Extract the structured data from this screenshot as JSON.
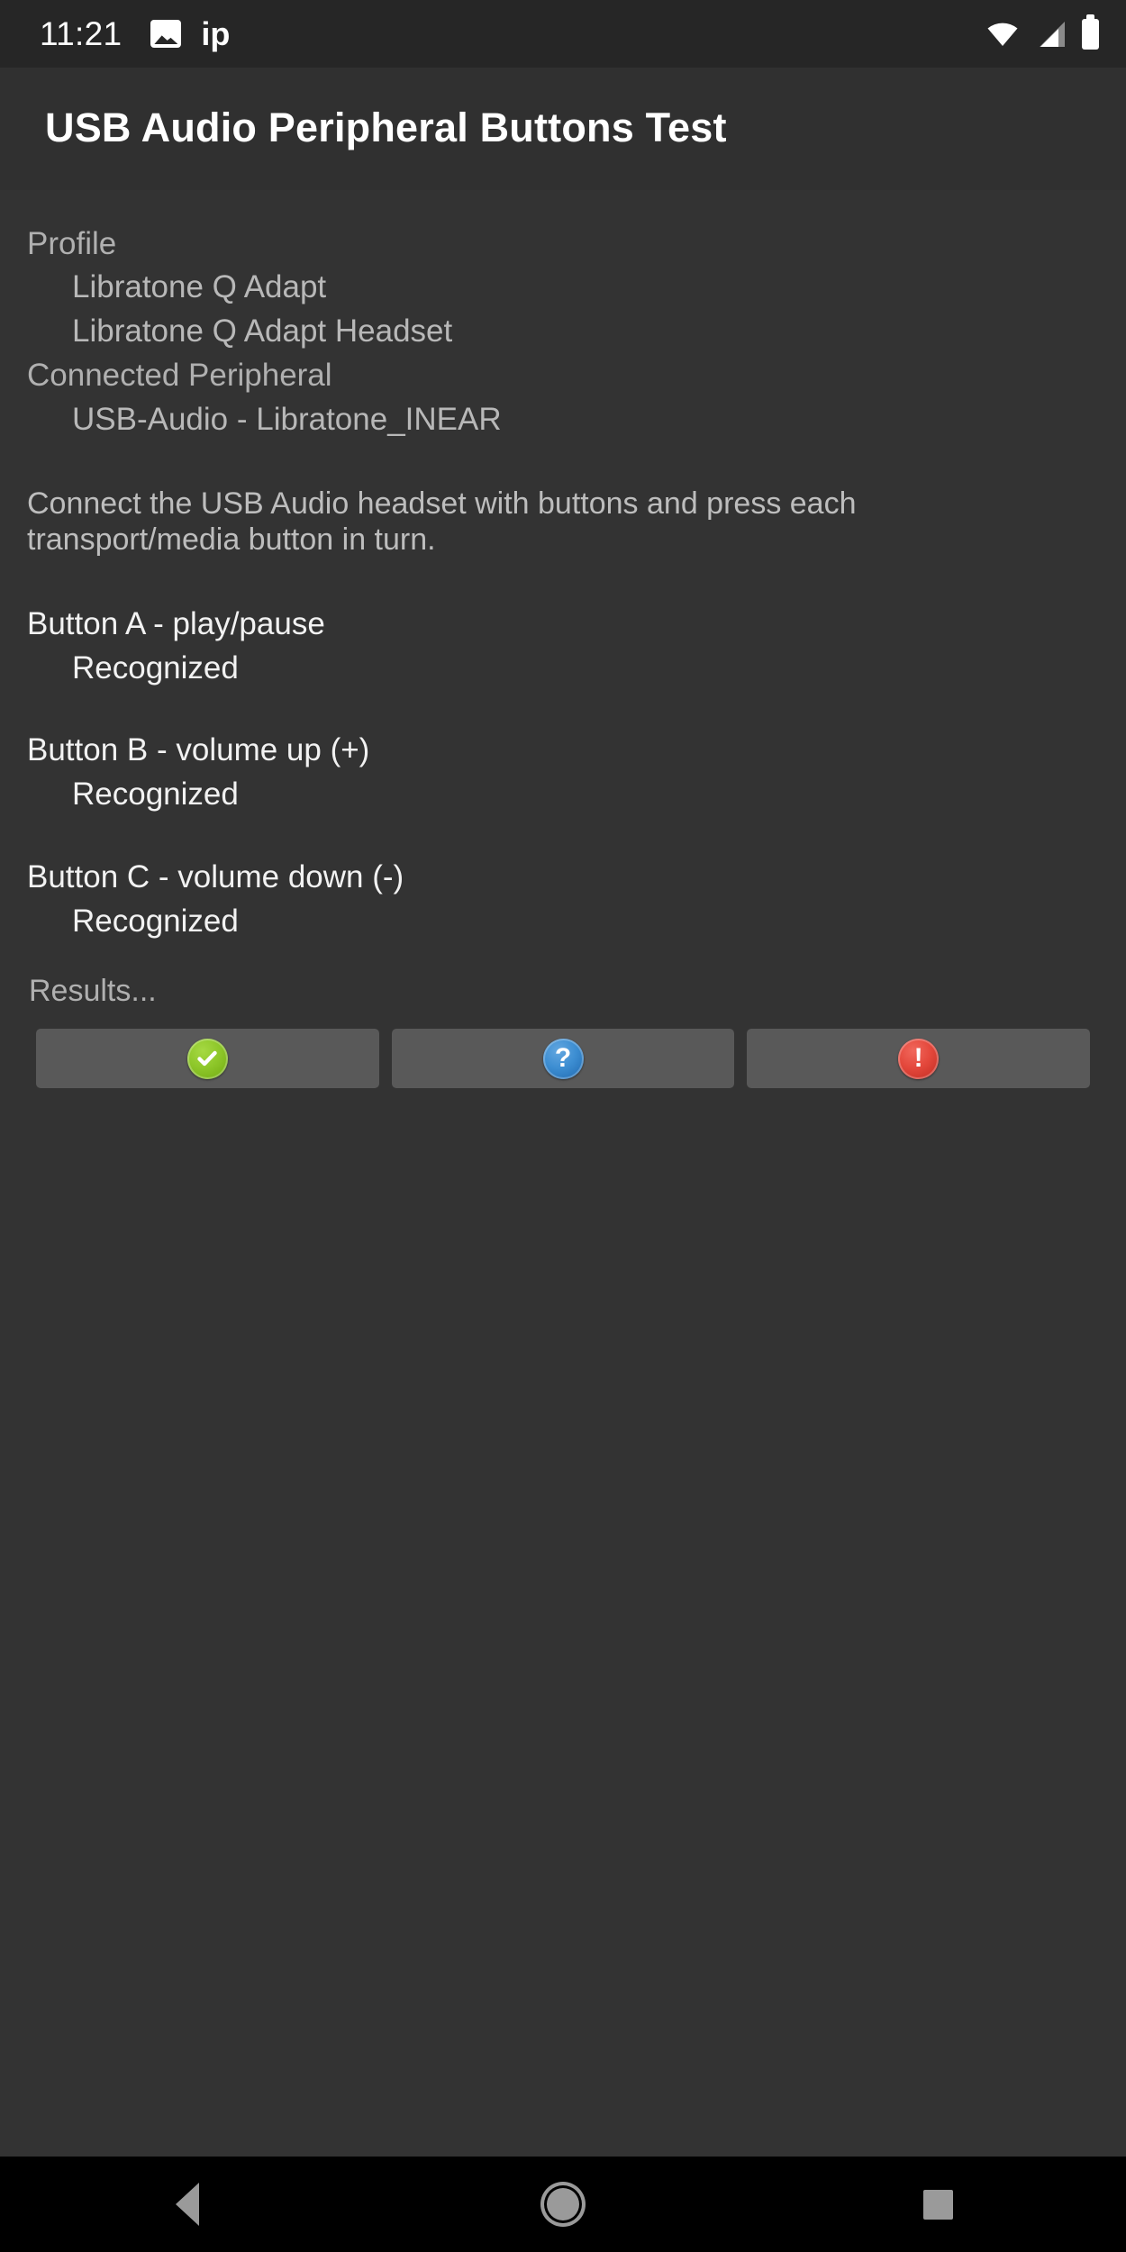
{
  "status_bar": {
    "clock": "11:21",
    "notification_label": "ip",
    "icons": {
      "photo": "photo-icon",
      "wifi": "wifi-icon",
      "signal": "signal-icon",
      "battery": "battery-icon"
    }
  },
  "header": {
    "title": "USB Audio Peripheral Buttons Test"
  },
  "profile": {
    "label": "Profile",
    "values": [
      "Libratone Q Adapt",
      "Libratone Q Adapt Headset"
    ]
  },
  "peripheral": {
    "label": "Connected Peripheral",
    "value": "USB-Audio - Libratone_INEAR"
  },
  "instructions": "Connect the USB Audio headset with buttons and press each transport/media button in turn.",
  "tests": [
    {
      "title": "Button A - play/pause",
      "status": "Recognized"
    },
    {
      "title": "Button B - volume up (+)",
      "status": "Recognized"
    },
    {
      "title": "Button C - volume down (-)",
      "status": "Recognized"
    }
  ],
  "results": {
    "label": "Results...",
    "buttons": [
      {
        "name": "pass-button",
        "icon": "check-circle-icon",
        "glyph": "✔",
        "color": "#8ec72a"
      },
      {
        "name": "info-button",
        "icon": "question-circle-icon",
        "glyph": "?",
        "color": "#3d8ed2"
      },
      {
        "name": "fail-button",
        "icon": "exclamation-circle-icon",
        "glyph": "!",
        "color": "#e4483c"
      }
    ]
  },
  "nav_bar": {
    "back_label": "Back",
    "home_label": "Home",
    "recents_label": "Recents"
  },
  "colors": {
    "status_bar_bg": "#262626",
    "title_bg": "#303030",
    "content_bg": "#333333",
    "button_bg": "#595959",
    "nav_bg": "#000000",
    "muted_text": "#b0b0b0",
    "primary_text": "#ffffff"
  }
}
